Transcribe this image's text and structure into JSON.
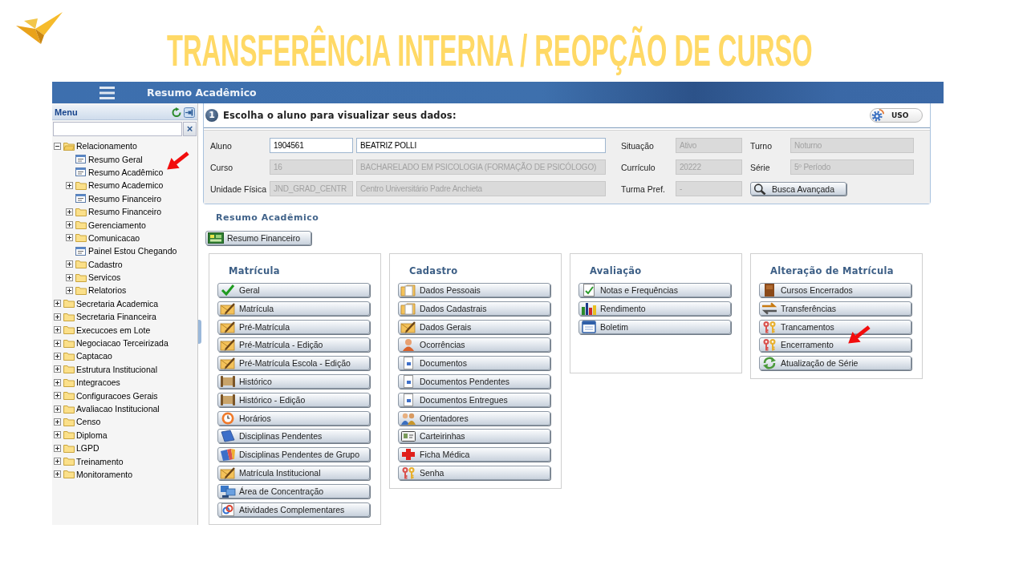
{
  "slide_title": "TRANSFERÊNCIA INTERNA / REOPÇÃO DE CURSO",
  "topbar": {
    "title": "Resumo Acadêmico"
  },
  "sidebar": {
    "title": "Menu",
    "clear_button": "×",
    "tree": [
      {
        "label": "Relacionamento",
        "kind": "folder",
        "expanded": true,
        "children": [
          {
            "label": "Resumo Geral",
            "kind": "page"
          },
          {
            "label": "Resumo Acadêmico",
            "kind": "page"
          },
          {
            "label": "Resumo Academico",
            "kind": "folder",
            "expanded": false
          },
          {
            "label": "Resumo Financeiro",
            "kind": "page"
          },
          {
            "label": "Resumo Financeiro",
            "kind": "folder",
            "expanded": false
          },
          {
            "label": "Gerenciamento",
            "kind": "folder",
            "expanded": false
          },
          {
            "label": "Comunicacao",
            "kind": "folder",
            "expanded": false
          },
          {
            "label": "Painel Estou Chegando",
            "kind": "page"
          },
          {
            "label": "Cadastro",
            "kind": "folder",
            "expanded": false
          },
          {
            "label": "Servicos",
            "kind": "folder",
            "expanded": false
          },
          {
            "label": "Relatorios",
            "kind": "folder",
            "expanded": false
          }
        ]
      },
      {
        "label": "Secretaria Academica",
        "kind": "folder",
        "expanded": false
      },
      {
        "label": "Secretaria Financeira",
        "kind": "folder",
        "expanded": false
      },
      {
        "label": "Execucoes em Lote",
        "kind": "folder",
        "expanded": false
      },
      {
        "label": "Negociacao Terceirizada",
        "kind": "folder",
        "expanded": false
      },
      {
        "label": "Captacao",
        "kind": "folder",
        "expanded": false
      },
      {
        "label": "Estrutura Institucional",
        "kind": "folder",
        "expanded": false
      },
      {
        "label": "Integracoes",
        "kind": "folder",
        "expanded": false
      },
      {
        "label": "Configuracoes Gerais",
        "kind": "folder",
        "expanded": false
      },
      {
        "label": "Avaliacao Institucional",
        "kind": "folder",
        "expanded": false
      },
      {
        "label": "Censo",
        "kind": "folder",
        "expanded": false
      },
      {
        "label": "Diploma",
        "kind": "folder",
        "expanded": false
      },
      {
        "label": "LGPD",
        "kind": "folder",
        "expanded": false
      },
      {
        "label": "Treinamento",
        "kind": "folder",
        "expanded": false
      },
      {
        "label": "Monitoramento",
        "kind": "folder",
        "expanded": false
      }
    ]
  },
  "student_panel": {
    "step": "1",
    "title": "Escolha o aluno para visualizar seus dados:",
    "uso_button": "USO",
    "rows": [
      {
        "items": [
          {
            "kind": "label",
            "text": "Aluno"
          },
          {
            "kind": "input",
            "value": "1904561",
            "disabled": false
          },
          {
            "kind": "input",
            "value": "BEATRIZ POLLI",
            "disabled": false
          },
          {
            "kind": "label",
            "text": "Situação"
          },
          {
            "kind": "input",
            "value": "Ativo",
            "disabled": true
          },
          {
            "kind": "label",
            "text": "Turno"
          },
          {
            "kind": "input",
            "value": "Noturno",
            "disabled": true
          }
        ]
      },
      {
        "items": [
          {
            "kind": "label",
            "text": "Curso"
          },
          {
            "kind": "input",
            "value": "16",
            "disabled": true
          },
          {
            "kind": "input",
            "value": "BACHARELADO EM PSICOLOGIA (FORMAÇÃO DE PSICÓLOGO)",
            "disabled": true
          },
          {
            "kind": "label",
            "text": "Currículo"
          },
          {
            "kind": "input",
            "value": "20222",
            "disabled": true
          },
          {
            "kind": "label",
            "text": "Série"
          },
          {
            "kind": "input",
            "value": "5º Período",
            "disabled": true
          }
        ]
      },
      {
        "items": [
          {
            "kind": "label",
            "text": "Unidade Física"
          },
          {
            "kind": "input",
            "value": "JND_GRAD_CENTR",
            "disabled": true
          },
          {
            "kind": "input",
            "value": "Centro Universitário Padre Anchieta",
            "disabled": true
          },
          {
            "kind": "label",
            "text": "Turma Pref."
          },
          {
            "kind": "input",
            "value": "-",
            "disabled": true
          },
          {
            "kind": "button",
            "text": "Busca Avançada"
          }
        ]
      }
    ]
  },
  "summary": {
    "title": "Resumo Acadêmico",
    "button": "Resumo Financeiro"
  },
  "sections": [
    {
      "title": "Matrícula",
      "buttons": [
        "Geral",
        "Matrícula",
        "Pré-Matrícula",
        "Pré-Matrícula - Edição",
        "Pré-Matrícula Escola - Edição",
        "Histórico",
        "Histórico - Edição",
        "Horários",
        "Disciplinas Pendentes",
        "Disciplinas Pendentes de Grupo",
        "Matrícula Institucional",
        "Área de Concentração",
        "Atividades Complementares"
      ]
    },
    {
      "title": "Cadastro",
      "buttons": [
        "Dados Pessoais",
        "Dados Cadastrais",
        "Dados Gerais",
        "Ocorrências",
        "Documentos",
        "Documentos Pendentes",
        "Documentos Entregues",
        "Orientadores",
        "Carteirinhas",
        "Ficha Médica",
        "Senha"
      ]
    },
    {
      "title": "Avaliação",
      "buttons": [
        "Notas e Frequências",
        "Rendimento",
        "Boletim"
      ]
    },
    {
      "title": "Alteração de Matrícula",
      "buttons": [
        "Cursos Encerrados",
        "Transferências",
        "Trancamentos",
        "Encerramento",
        "Atualização de Série"
      ]
    }
  ]
}
